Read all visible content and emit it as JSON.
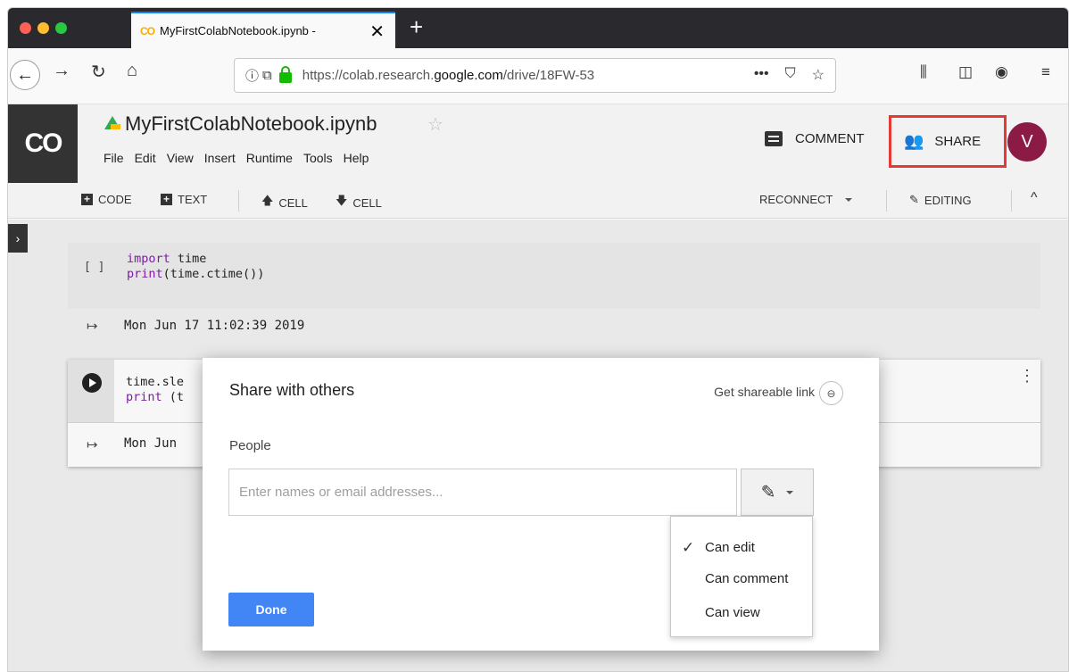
{
  "browser": {
    "tab_title": "MyFirstColabNotebook.ipynb - ",
    "tab_favicon": "CO",
    "new_tab": "+",
    "url_prefix": "https://colab.research.",
    "url_domain": "google.com",
    "url_suffix": "/drive/18FW-53"
  },
  "colab": {
    "logo": "CO",
    "notebook_title": "MyFirstColabNotebook.ipynb",
    "menu": [
      "File",
      "Edit",
      "View",
      "Insert",
      "Runtime",
      "Tools",
      "Help"
    ],
    "comment_label": "COMMENT",
    "share_label": "SHARE",
    "avatar_initial": "V"
  },
  "toolbar": {
    "code_label": "CODE",
    "text_label": "TEXT",
    "cell_up_label": "CELL",
    "cell_down_label": "CELL",
    "reconnect_label": "RECONNECT",
    "editing_label": "EDITING"
  },
  "cells": {
    "cell1_bracket": "[ ]",
    "cell1_line1_kw": "import",
    "cell1_line1_rest": " time",
    "cell1_line2_kw": "print",
    "cell1_line2_rest": "(time.ctime())",
    "cell1_output": "Mon Jun 17 11:02:39 2019",
    "cell2_line1": "time.sle",
    "cell2_line2_kw": "print",
    "cell2_line2_rest": " (t",
    "cell2_output": "Mon Jun"
  },
  "modal": {
    "title": "Share with others",
    "shareable_link": "Get shareable link",
    "people_label": "People",
    "input_placeholder": "Enter names or email addresses...",
    "done_label": "Done"
  },
  "permissions": {
    "options": [
      "Can edit",
      "Can comment",
      "Can view"
    ],
    "selected": "Can edit"
  },
  "colors": {
    "share_highlight": "#e53935",
    "done_button": "#4285f4",
    "avatar": "#8b1b45"
  }
}
